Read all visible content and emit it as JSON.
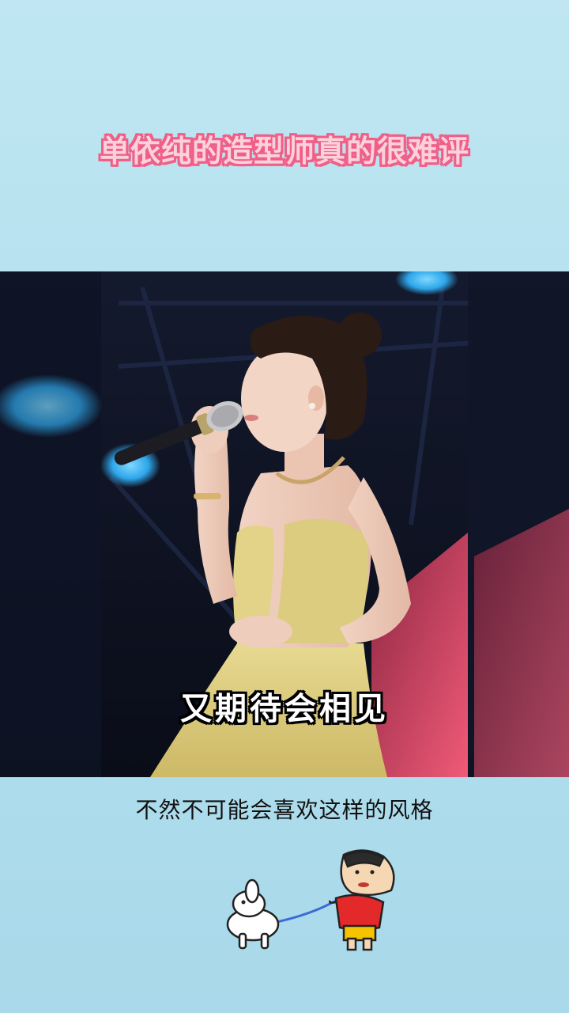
{
  "title": "单依纯的造型师真的很难评",
  "video": {
    "subtitle": "又期待会相见"
  },
  "caption": "不然不可能会喜欢这样的风格",
  "sticker": {
    "icon": "crayon-shinchan-walking-dog-icon"
  },
  "colors": {
    "background": "#b6e1f0",
    "title_fill": "#fbd1dc",
    "title_stroke": "#ef5f88",
    "dress": "#d9c97a",
    "stage_light": "#35b4f0"
  }
}
